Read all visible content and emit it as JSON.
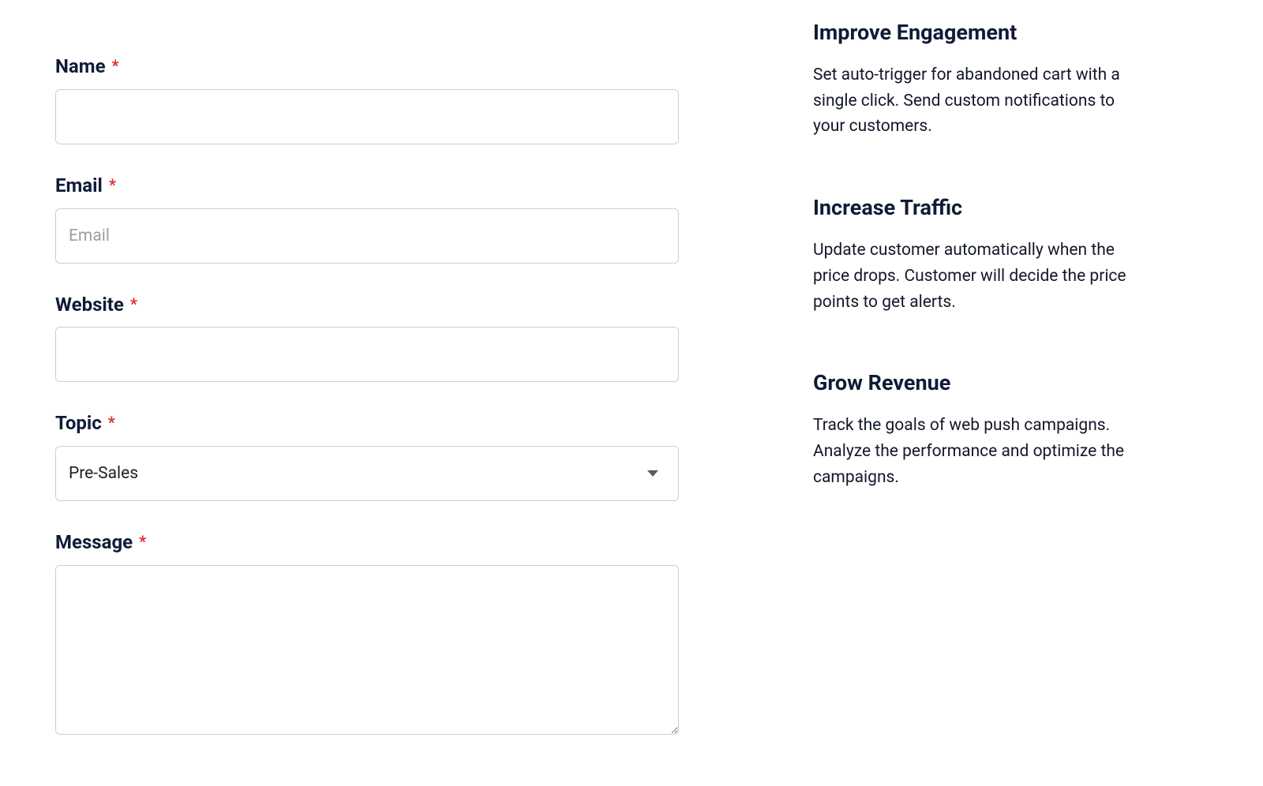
{
  "form": {
    "name": {
      "label": "Name",
      "required": "*",
      "value": "",
      "placeholder": ""
    },
    "email": {
      "label": "Email",
      "required": "*",
      "value": "",
      "placeholder": "Email"
    },
    "website": {
      "label": "Website",
      "required": "*",
      "value": "",
      "placeholder": ""
    },
    "topic": {
      "label": "Topic",
      "required": "*",
      "selected": "Pre-Sales"
    },
    "message": {
      "label": "Message",
      "required": "*",
      "value": "",
      "placeholder": ""
    }
  },
  "sidebar": {
    "blocks": [
      {
        "title": "Improve Engagement",
        "text": "Set auto-trigger for abandoned cart with a single click. Send custom notifications to your customers."
      },
      {
        "title": "Increase Traffic",
        "text": "Update customer automatically when the price drops. Customer will decide the price points to get alerts."
      },
      {
        "title": "Grow Revenue",
        "text": "Track the goals of web push campaigns. Analyze the performance and optimize the campaigns."
      }
    ]
  }
}
